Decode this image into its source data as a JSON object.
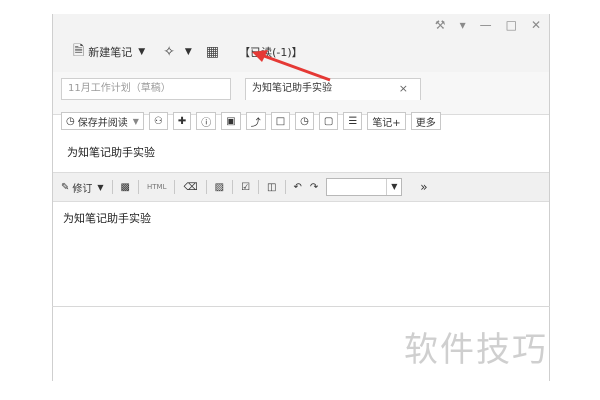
{
  "window_controls": {
    "pin": "⚒",
    "menu": "▾",
    "minimize": "—",
    "maximize": "□",
    "close": "✕"
  },
  "top_toolbar": {
    "new_note_label": "新建笔记",
    "read_status": "【已读(-1)】"
  },
  "tabs": [
    {
      "label": "11月工作计划（草稿）"
    },
    {
      "label": "为知笔记助手实验",
      "close": "×"
    }
  ],
  "note_toolbar": {
    "save_and_read": "保存并阅读",
    "note_plus": "笔记+",
    "more": "更多"
  },
  "note": {
    "title": "为知笔记助手实验",
    "body": "为知笔记助手实验"
  },
  "edit_toolbar": {
    "revise": "修订",
    "html_label": "HTML",
    "more_symbol": "»"
  },
  "watermark": "软件技巧",
  "colors": {
    "arrow": "#e53935"
  }
}
